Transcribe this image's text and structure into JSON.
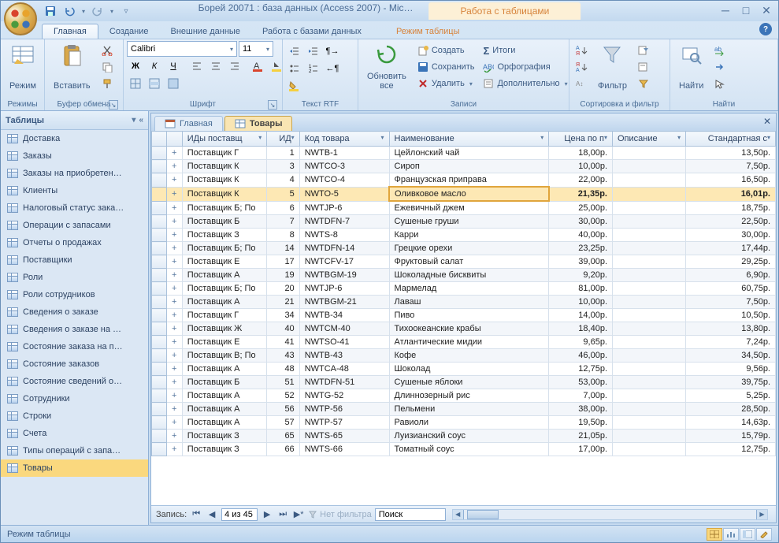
{
  "title": "Борей 20071 : база данных (Access 2007) - Mic…",
  "contextual_title": "Работа с таблицами",
  "tabs": [
    "Главная",
    "Создание",
    "Внешние данные",
    "Работа с базами данных",
    "Режим таблицы"
  ],
  "active_tab": 0,
  "font_name": "Calibri",
  "font_size": "11",
  "groups": {
    "g1": "Режимы",
    "g2": "Буфер обмена",
    "g3": "Шрифт",
    "g4": "Текст RTF",
    "g5": "Записи",
    "g6": "Сортировка и фильтр",
    "g7": "Найти"
  },
  "btn": {
    "mode": "Режим",
    "paste": "Вставить",
    "refresh": "Обновить\nвсе",
    "filter": "Фильтр",
    "find": "Найти",
    "create": "Создать",
    "save": "Сохранить",
    "delete": "Удалить",
    "totals": "Итоги",
    "spell": "Орфография",
    "more": "Дополнительно"
  },
  "nav": {
    "title": "Таблицы",
    "items": [
      "Доставка",
      "Заказы",
      "Заказы на приобретен…",
      "Клиенты",
      "Налоговый статус зака…",
      "Операции с запасами",
      "Отчеты о продажах",
      "Поставщики",
      "Роли",
      "Роли сотрудников",
      "Сведения о заказе",
      "Сведения о заказе на …",
      "Состояние заказа на п…",
      "Состояние заказов",
      "Состояние сведений о…",
      "Сотрудники",
      "Строки",
      "Счета",
      "Типы операций с запа…",
      "Товары"
    ],
    "selected": 19
  },
  "doc_tabs": [
    {
      "label": "Главная",
      "active": false
    },
    {
      "label": "Товары",
      "active": true
    }
  ],
  "columns": [
    "ИДы поставщ",
    "ИД",
    "Код товара",
    "Наименование",
    "Цена по п",
    "Описание",
    "Стандартная с"
  ],
  "rows": [
    {
      "s": "Поставщик Г",
      "id": 1,
      "code": "NWTB-1",
      "name": "Цейлонский чай",
      "p": "18,00р.",
      "d": "",
      "std": "13,50р."
    },
    {
      "s": "Поставщик К",
      "id": 3,
      "code": "NWTCO-3",
      "name": "Сироп",
      "p": "10,00р.",
      "d": "",
      "std": "7,50р."
    },
    {
      "s": "Поставщик К",
      "id": 4,
      "code": "NWTCO-4",
      "name": "Французская приправа",
      "p": "22,00р.",
      "d": "",
      "std": "16,50р."
    },
    {
      "s": "Поставщик К",
      "id": 5,
      "code": "NWTO-5",
      "name": "Оливковое масло",
      "p": "21,35р.",
      "d": "",
      "std": "16,01р.",
      "sel": true
    },
    {
      "s": "Поставщик Б; По",
      "id": 6,
      "code": "NWTJP-6",
      "name": "Ежевичный джем",
      "p": "25,00р.",
      "d": "",
      "std": "18,75р."
    },
    {
      "s": "Поставщик Б",
      "id": 7,
      "code": "NWTDFN-7",
      "name": "Сушеные груши",
      "p": "30,00р.",
      "d": "",
      "std": "22,50р."
    },
    {
      "s": "Поставщик З",
      "id": 8,
      "code": "NWTS-8",
      "name": "Карри",
      "p": "40,00р.",
      "d": "",
      "std": "30,00р."
    },
    {
      "s": "Поставщик Б; По",
      "id": 14,
      "code": "NWTDFN-14",
      "name": "Грецкие орехи",
      "p": "23,25р.",
      "d": "",
      "std": "17,44р."
    },
    {
      "s": "Поставщик Е",
      "id": 17,
      "code": "NWTCFV-17",
      "name": "Фруктовый салат",
      "p": "39,00р.",
      "d": "",
      "std": "29,25р."
    },
    {
      "s": "Поставщик А",
      "id": 19,
      "code": "NWTBGM-19",
      "name": "Шоколадные бисквиты",
      "p": "9,20р.",
      "d": "",
      "std": "6,90р."
    },
    {
      "s": "Поставщик Б; По",
      "id": 20,
      "code": "NWTJP-6",
      "name": "Мармелад",
      "p": "81,00р.",
      "d": "",
      "std": "60,75р."
    },
    {
      "s": "Поставщик А",
      "id": 21,
      "code": "NWTBGM-21",
      "name": "Лаваш",
      "p": "10,00р.",
      "d": "",
      "std": "7,50р."
    },
    {
      "s": "Поставщик Г",
      "id": 34,
      "code": "NWTB-34",
      "name": "Пиво",
      "p": "14,00р.",
      "d": "",
      "std": "10,50р."
    },
    {
      "s": "Поставщик Ж",
      "id": 40,
      "code": "NWTCM-40",
      "name": "Тихоокеанские крабы",
      "p": "18,40р.",
      "d": "",
      "std": "13,80р."
    },
    {
      "s": "Поставщик Е",
      "id": 41,
      "code": "NWTSO-41",
      "name": "Атлантические мидии",
      "p": "9,65р.",
      "d": "",
      "std": "7,24р."
    },
    {
      "s": "Поставщик В; По",
      "id": 43,
      "code": "NWTB-43",
      "name": "Кофе",
      "p": "46,00р.",
      "d": "",
      "std": "34,50р."
    },
    {
      "s": "Поставщик А",
      "id": 48,
      "code": "NWTCA-48",
      "name": "Шоколад",
      "p": "12,75р.",
      "d": "",
      "std": "9,56р."
    },
    {
      "s": "Поставщик Б",
      "id": 51,
      "code": "NWTDFN-51",
      "name": "Сушеные яблоки",
      "p": "53,00р.",
      "d": "",
      "std": "39,75р."
    },
    {
      "s": "Поставщик А",
      "id": 52,
      "code": "NWTG-52",
      "name": "Длиннозерный рис",
      "p": "7,00р.",
      "d": "",
      "std": "5,25р."
    },
    {
      "s": "Поставщик А",
      "id": 56,
      "code": "NWTP-56",
      "name": "Пельмени",
      "p": "38,00р.",
      "d": "",
      "std": "28,50р."
    },
    {
      "s": "Поставщик А",
      "id": 57,
      "code": "NWTP-57",
      "name": "Равиоли",
      "p": "19,50р.",
      "d": "",
      "std": "14,63р."
    },
    {
      "s": "Поставщик З",
      "id": 65,
      "code": "NWTS-65",
      "name": "Луизианский соус",
      "p": "21,05р.",
      "d": "",
      "std": "15,79р."
    },
    {
      "s": "Поставщик З",
      "id": 66,
      "code": "NWTS-66",
      "name": "Томатный соус",
      "p": "17,00р.",
      "d": "",
      "std": "12,75р."
    }
  ],
  "record_nav": {
    "label": "Запись:",
    "pos": "4 из 45",
    "nofilter": "Нет фильтра",
    "search": "Поиск"
  },
  "status": "Режим таблицы"
}
